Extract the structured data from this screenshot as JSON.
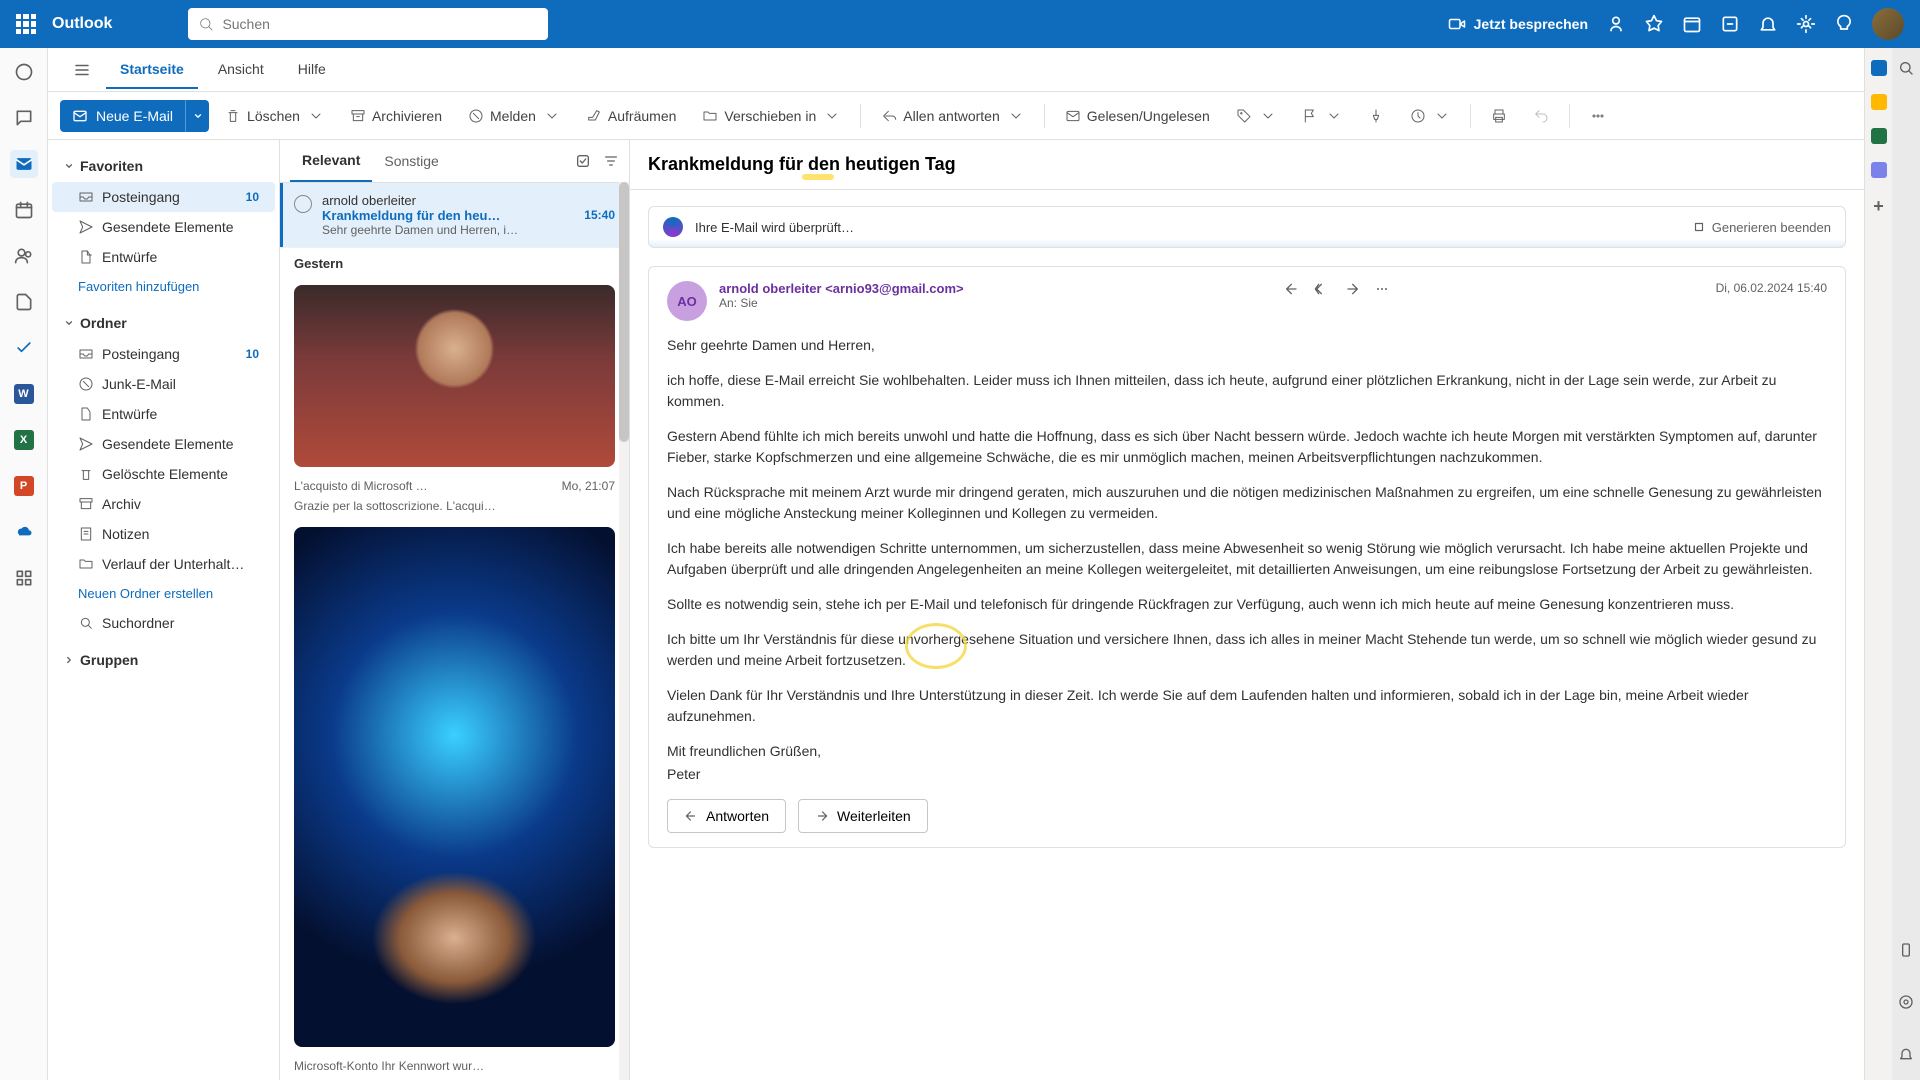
{
  "header": {
    "brand": "Outlook",
    "search_placeholder": "Suchen",
    "meet_label": "Jetzt besprechen"
  },
  "tabs": {
    "home": "Startseite",
    "view": "Ansicht",
    "help": "Hilfe"
  },
  "toolbar": {
    "new_mail": "Neue E-Mail",
    "delete": "Löschen",
    "archive": "Archivieren",
    "report": "Melden",
    "sweep": "Aufräumen",
    "move": "Verschieben in",
    "reply_all": "Allen antworten",
    "read_unread": "Gelesen/Ungelesen"
  },
  "nav": {
    "favorites": "Favoriten",
    "folders": "Ordner",
    "groups": "Gruppen",
    "inbox": "Posteingang",
    "sent": "Gesendete Elemente",
    "drafts": "Entwürfe",
    "add_fav": "Favoriten hinzufügen",
    "junk": "Junk-E-Mail",
    "deleted": "Gelöschte Elemente",
    "archive": "Archiv",
    "notes": "Notizen",
    "conv": "Verlauf der Unterhalt…",
    "new_folder": "Neuen Ordner erstellen",
    "search_folders": "Suchordner",
    "inbox_count": "10"
  },
  "list": {
    "tab_focused": "Relevant",
    "tab_other": "Sonstige",
    "msg1": {
      "from": "arnold oberleiter",
      "subject": "Krankmeldung für den heu…",
      "time": "15:40",
      "preview": "Sehr geehrte Damen und Herren, i…"
    },
    "group_yesterday": "Gestern",
    "msg2": {
      "subject": "L'acquisto di Microsoft …",
      "time": "Mo, 21:07",
      "preview": "Grazie per la sottoscrizione. L'acqui…"
    },
    "msg3_preview": "Microsoft-Konto Ihr Kennwort wur…"
  },
  "reader": {
    "subject": "Krankmeldung für den heutigen Tag",
    "ai_check": "Ihre E-Mail wird überprüft…",
    "ai_stop": "Generieren beenden",
    "from_name": "arnold oberleiter",
    "from_email": "<arnio93@gmail.com>",
    "to_label": "An:",
    "to_value": "Sie",
    "date": "Di, 06.02.2024 15:40",
    "avatar_initials": "AO",
    "p1": "Sehr geehrte Damen und Herren,",
    "p2": "ich hoffe, diese E-Mail erreicht Sie wohlbehalten. Leider muss ich Ihnen mitteilen, dass ich heute, aufgrund einer plötzlichen Erkrankung, nicht in der Lage sein werde, zur Arbeit zu kommen.",
    "p3": "Gestern Abend fühlte ich mich bereits unwohl und hatte die Hoffnung, dass es sich über Nacht bessern würde. Jedoch wachte ich heute Morgen mit verstärkten Symptomen auf, darunter Fieber, starke Kopfschmerzen und eine allgemeine Schwäche, die es mir unmöglich machen, meinen Arbeitsverpflichtungen nachzukommen.",
    "p4": "Nach Rücksprache mit meinem Arzt wurde mir dringend geraten, mich auszuruhen und die nötigen medizinischen Maßnahmen zu ergreifen, um eine schnelle Genesung zu gewährleisten und eine mögliche Ansteckung meiner Kolleginnen und Kollegen zu vermeiden.",
    "p5": "Ich habe bereits alle notwendigen Schritte unternommen, um sicherzustellen, dass meine Abwesenheit so wenig Störung wie möglich verursacht. Ich habe meine aktuellen Projekte und Aufgaben überprüft und alle dringenden Angelegenheiten an meine Kollegen weitergeleitet, mit detaillierten Anweisungen, um eine reibungslose Fortsetzung der Arbeit zu gewährleisten.",
    "p6": "Sollte es notwendig sein, stehe ich per E-Mail und telefonisch für dringende Rückfragen zur Verfügung, auch wenn ich mich heute auf meine Genesung konzentrieren muss.",
    "p7": "Ich bitte um Ihr Verständnis für diese unvorhergesehene Situation und versichere Ihnen, dass ich alles in meiner Macht Stehende tun werde, um so schnell wie möglich wieder gesund zu werden und meine Arbeit fortzusetzen.",
    "p8": "Vielen Dank für Ihr Verständnis und Ihre Unterstützung in dieser Zeit. Ich werde Sie auf dem Laufenden halten und informieren, sobald ich in der Lage bin, meine Arbeit wieder aufzunehmen.",
    "p9": "Mit freundlichen Grüßen,",
    "p10": "Peter",
    "reply": "Antworten",
    "forward": "Weiterleiten"
  }
}
